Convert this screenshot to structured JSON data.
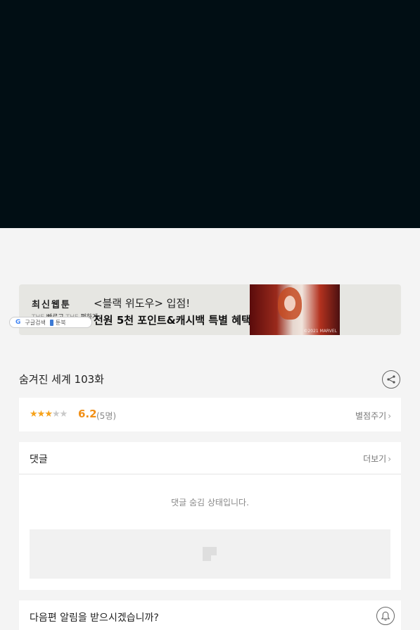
{
  "banner": {
    "brand_title": "최신웹툰",
    "brand_sub_prefix1": "THE",
    "brand_sub_1": "빠르고",
    "brand_sub_prefix2": "THE",
    "brand_sub_2": "편하게",
    "pill_google": "G",
    "pill_search": "구글검색",
    "pill_app": "툰북",
    "headline_line1": "<블랙 위도우> 입점!",
    "headline_line2": "전원 5천 포인트&캐시백 특별 혜택",
    "poster_copyright": "©2021 MARVEL"
  },
  "episode": {
    "title": "숨겨진 세계 103화"
  },
  "rating": {
    "stars_filled": 3,
    "stars_total": 5,
    "score": "6.2",
    "count": "(5명)",
    "rate_label": "별점주기"
  },
  "comments": {
    "label": "댓글",
    "more_label": "더보기",
    "hidden_message": "댓글 숨김 상태입니다."
  },
  "notify": {
    "label": "다음편 알림을 받으시겠습니까?"
  },
  "icons": {
    "share": "share-icon",
    "bell": "bell-icon",
    "chevron": "chevron-right-icon",
    "ad_placeholder": "image-placeholder-icon"
  },
  "colors": {
    "hero_bg": "#010e14",
    "star_on": "#f6a21a",
    "score": "#f18f16"
  }
}
